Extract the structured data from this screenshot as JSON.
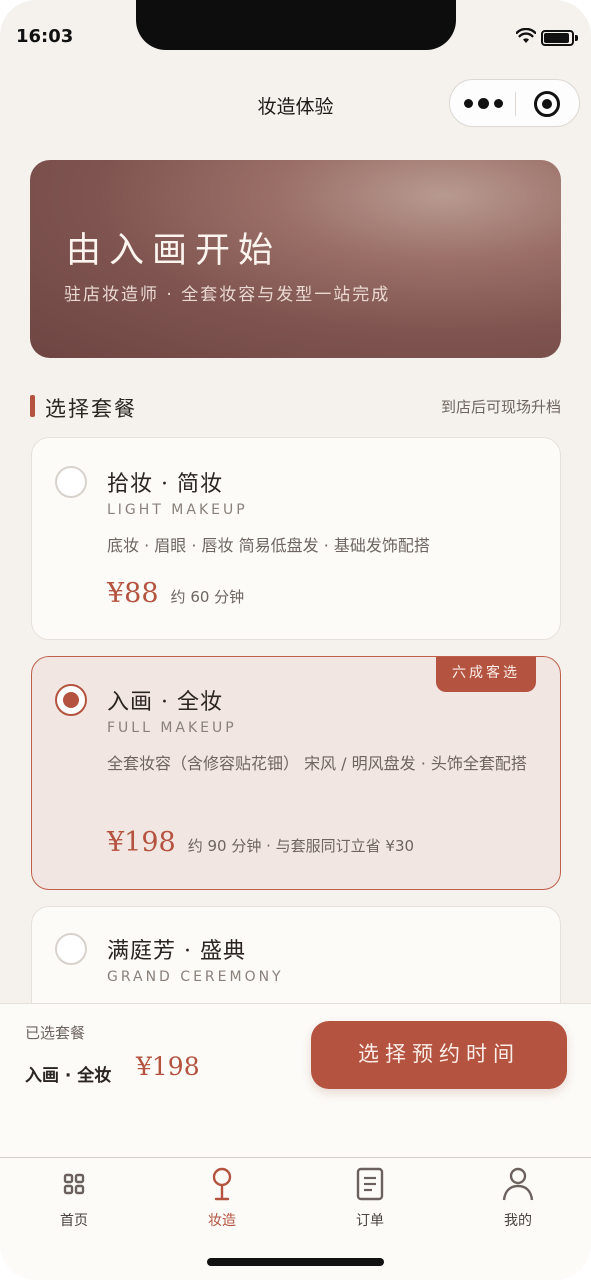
{
  "status": {
    "time": "16:03"
  },
  "nav": {
    "title": "妆造体验"
  },
  "hero": {
    "title": "由入画开始",
    "subtitle": "驻店妆造师 · 全套妆容与发型一站完成"
  },
  "section": {
    "title": "选择套餐",
    "note": "到店后可现场升档"
  },
  "packages": [
    {
      "name": "拾妆 · 简妆",
      "en": "LIGHT MAKEUP",
      "desc": "底妆 · 眉眼 · 唇妆 简易低盘发 · 基础发饰配搭",
      "price": "¥88",
      "note": "约 60 分钟",
      "selected": false
    },
    {
      "name": "入画 · 全妆",
      "en": "FULL MAKEUP",
      "desc": "全套妆容（含修容贴花钿） 宋风 / 明风盘发 · 头饰全套配搭",
      "price": "¥198",
      "note": "约 90 分钟 · 与套服同订立省 ¥30",
      "badge": "六成客选",
      "selected": true
    },
    {
      "name": "满庭芳 · 盛典",
      "en": "GRAND CEREMONY",
      "selected": false
    }
  ],
  "summary": {
    "label": "已选套餐",
    "name": "入画 · 全妆",
    "price": "¥198",
    "cta": "选择预约时间"
  },
  "tabs": [
    {
      "label": "首页",
      "icon": "grid-icon"
    },
    {
      "label": "妆造",
      "icon": "mirror-icon",
      "active": true
    },
    {
      "label": "订单",
      "icon": "document-icon"
    },
    {
      "label": "我的",
      "icon": "person-icon"
    }
  ],
  "colors": {
    "accent": "#b4533f",
    "background": "#f5f2ee"
  }
}
